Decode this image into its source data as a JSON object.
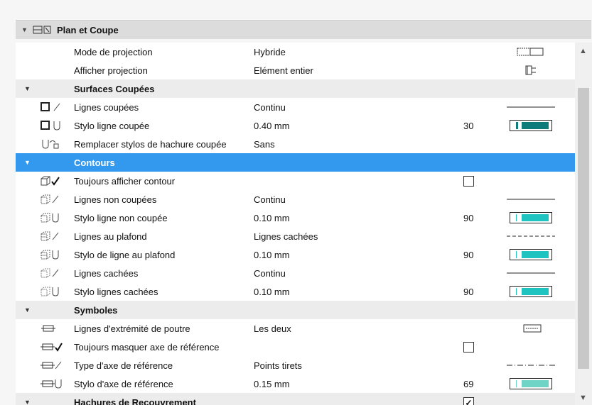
{
  "panel": {
    "title": "Plan et Coupe"
  },
  "rows": {
    "r0": {
      "label": "Mode de projection",
      "value": "Hybride"
    },
    "r1": {
      "label": "Afficher projection",
      "value": "Elément entier"
    },
    "s1": {
      "label": "Surfaces Coupées"
    },
    "r2": {
      "label": "Lignes coupées",
      "value": "Continu"
    },
    "r3": {
      "label": "Stylo ligne coupée",
      "value": "0.40 mm",
      "pen": "30",
      "pen_color": "#0f7c7c"
    },
    "r4": {
      "label": "Remplacer stylos de hachure coupée",
      "value": "Sans"
    },
    "s2": {
      "label": "Contours"
    },
    "r5": {
      "label": "Toujours afficher contour",
      "checked": false
    },
    "r6": {
      "label": "Lignes non coupées",
      "value": "Continu"
    },
    "r7": {
      "label": "Stylo ligne non coupée",
      "value": "0.10 mm",
      "pen": "90",
      "pen_color": "#1fc4c0"
    },
    "r8": {
      "label": "Lignes au plafond",
      "value": "Lignes cachées"
    },
    "r9": {
      "label": "Stylo de ligne au plafond",
      "value": "0.10 mm",
      "pen": "90",
      "pen_color": "#1fc4c0"
    },
    "r10": {
      "label": "Lignes cachées",
      "value": "Continu"
    },
    "r11": {
      "label": "Stylo lignes cachées",
      "value": "0.10 mm",
      "pen": "90",
      "pen_color": "#1fc4c0"
    },
    "s3": {
      "label": "Symboles"
    },
    "r12": {
      "label": "Lignes d'extrémité de poutre",
      "value": "Les deux"
    },
    "r13": {
      "label": "Toujours masquer axe de référence",
      "checked": false
    },
    "r14": {
      "label": "Type d'axe de référence",
      "value": "Points tirets"
    },
    "r15": {
      "label": "Stylo d'axe de référence",
      "value": "0.15 mm",
      "pen": "69",
      "pen_color": "#6fd3c6"
    },
    "s4": {
      "label": "Hachures de Recouvrement",
      "checked": true
    }
  },
  "colors": {
    "selection": "#3399ee",
    "section_bg": "#ececec",
    "header_bg": "#dcdcdc"
  }
}
